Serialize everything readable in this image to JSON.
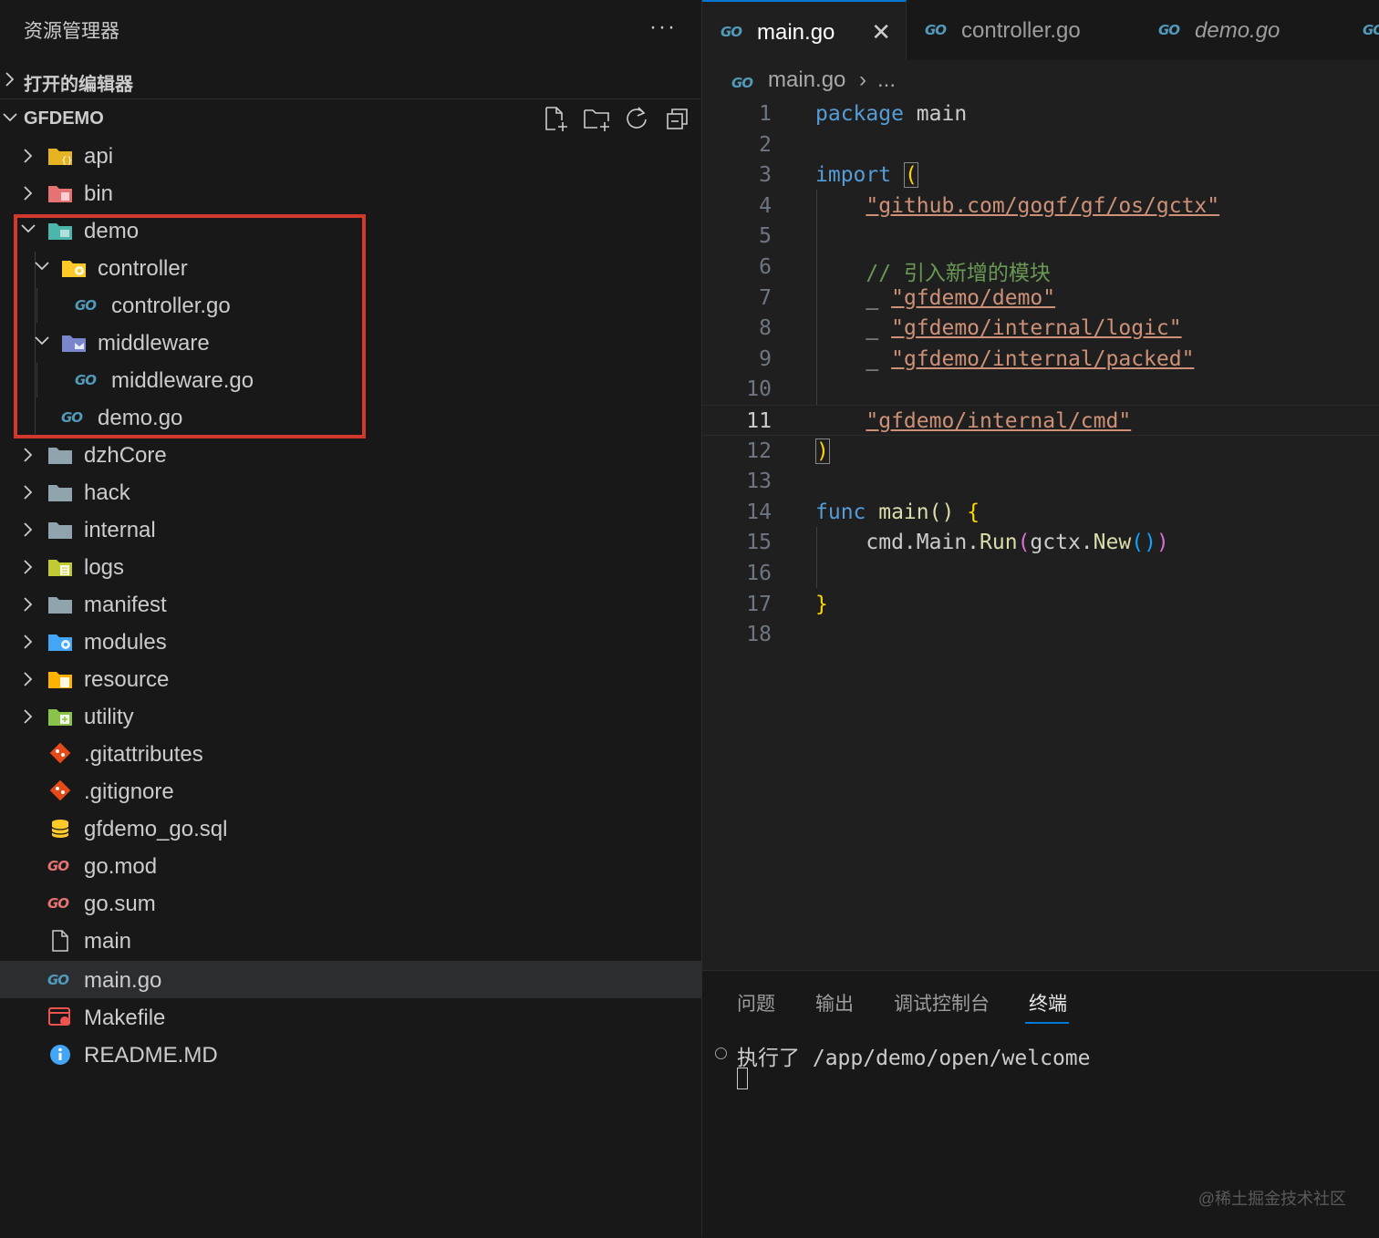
{
  "sidebar": {
    "title": "资源管理器",
    "more_label": "···",
    "open_editors_label": "打开的编辑器",
    "project_label": "GFDEMO",
    "toolbar_icons": [
      "new-file-icon",
      "new-folder-icon",
      "refresh-icon",
      "collapse-all-icon"
    ],
    "tree": [
      {
        "name": "api",
        "kind": "folder",
        "icon": "folder-api-icon",
        "color": "#e6b422",
        "expanded": false
      },
      {
        "name": "bin",
        "kind": "folder",
        "icon": "folder-bin-icon",
        "color": "#e57373",
        "expanded": false
      },
      {
        "name": "demo",
        "kind": "folder",
        "icon": "folder-demo-icon",
        "color": "#4db6ac",
        "expanded": true
      },
      {
        "name": "controller",
        "kind": "folder",
        "icon": "folder-controller-icon",
        "color": "#ffca28",
        "expanded": true
      },
      {
        "name": "controller.go",
        "kind": "file",
        "icon": "go-file-icon"
      },
      {
        "name": "middleware",
        "kind": "folder",
        "icon": "folder-middleware-icon",
        "color": "#7986cb",
        "expanded": true
      },
      {
        "name": "middleware.go",
        "kind": "file",
        "icon": "go-file-icon"
      },
      {
        "name": "demo.go",
        "kind": "file",
        "icon": "go-file-icon"
      },
      {
        "name": "dzhCore",
        "kind": "folder",
        "icon": "folder-icon",
        "color": "#90a4ae",
        "expanded": false
      },
      {
        "name": "hack",
        "kind": "folder",
        "icon": "folder-icon",
        "color": "#90a4ae",
        "expanded": false
      },
      {
        "name": "internal",
        "kind": "folder",
        "icon": "folder-icon",
        "color": "#90a4ae",
        "expanded": false
      },
      {
        "name": "logs",
        "kind": "folder",
        "icon": "folder-logs-icon",
        "color": "#c0ca33",
        "expanded": false
      },
      {
        "name": "manifest",
        "kind": "folder",
        "icon": "folder-icon",
        "color": "#90a4ae",
        "expanded": false
      },
      {
        "name": "modules",
        "kind": "folder",
        "icon": "folder-modules-icon",
        "color": "#42a5f5",
        "expanded": false
      },
      {
        "name": "resource",
        "kind": "folder",
        "icon": "folder-resource-icon",
        "color": "#ffb300",
        "expanded": false
      },
      {
        "name": "utility",
        "kind": "folder",
        "icon": "folder-utility-icon",
        "color": "#8bc34a",
        "expanded": false
      },
      {
        "name": ".gitattributes",
        "kind": "file",
        "icon": "git-icon"
      },
      {
        "name": ".gitignore",
        "kind": "file",
        "icon": "git-icon"
      },
      {
        "name": "gfdemo_go.sql",
        "kind": "file",
        "icon": "database-icon"
      },
      {
        "name": "go.mod",
        "kind": "file",
        "icon": "go-mod-icon"
      },
      {
        "name": "go.sum",
        "kind": "file",
        "icon": "go-mod-icon"
      },
      {
        "name": "main",
        "kind": "file",
        "icon": "file-icon"
      },
      {
        "name": "main.go",
        "kind": "file",
        "icon": "go-file-icon",
        "selected": true
      },
      {
        "name": "Makefile",
        "kind": "file",
        "icon": "makefile-icon"
      },
      {
        "name": "README.MD",
        "kind": "file",
        "icon": "info-icon"
      }
    ]
  },
  "editor": {
    "tabs": [
      {
        "label": "main.go",
        "active": true,
        "close": "✕"
      },
      {
        "label": "controller.go",
        "active": false
      },
      {
        "label": "demo.go",
        "active": false,
        "italic": true
      }
    ],
    "breadcrumb": {
      "file": "main.go",
      "sep": "›",
      "ellipsis": "..."
    },
    "current_line": 11,
    "lines": [
      "1",
      "2",
      "3",
      "4",
      "5",
      "6",
      "7",
      "8",
      "9",
      "10",
      "11",
      "12",
      "13",
      "14",
      "15",
      "16",
      "17",
      "18"
    ],
    "code": {
      "l1_kw": "package",
      "l1_rest": " main",
      "l3_kw": "import",
      "l3_paren": "(",
      "l4_str": "\"github.com/gogf/gf/os/gctx\"",
      "l6_cmt": "// 引入新增的模块",
      "l7_us": "_ ",
      "l7_str": "\"gfdemo/demo\"",
      "l8_us": "_ ",
      "l8_str": "\"gfdemo/internal/logic\"",
      "l9_us": "_ ",
      "l9_str": "\"gfdemo/internal/packed\"",
      "l11_str": "\"gfdemo/internal/cmd\"",
      "l12_paren": ")",
      "l14_kw": "func",
      "l14_fn": " main",
      "l14_par": "()",
      "l14_brace": " {",
      "l15_a": "cmd.Main.",
      "l15_run": "Run",
      "l15_p1": "(",
      "l15_b": "gctx.",
      "l15_new": "New",
      "l15_p2": "()",
      "l15_p3": ")",
      "l17_brace": "}"
    }
  },
  "panel": {
    "tabs": [
      "问题",
      "输出",
      "调试控制台",
      "终端"
    ],
    "active_tab": "终端",
    "terminal_line": "执行了 /app/demo/open/welcome"
  },
  "watermark": "@稀土掘金技术社区",
  "colors": {
    "accent": "#0078d4",
    "highlight_box": "#d1382e",
    "go_icon": "#519aba"
  }
}
